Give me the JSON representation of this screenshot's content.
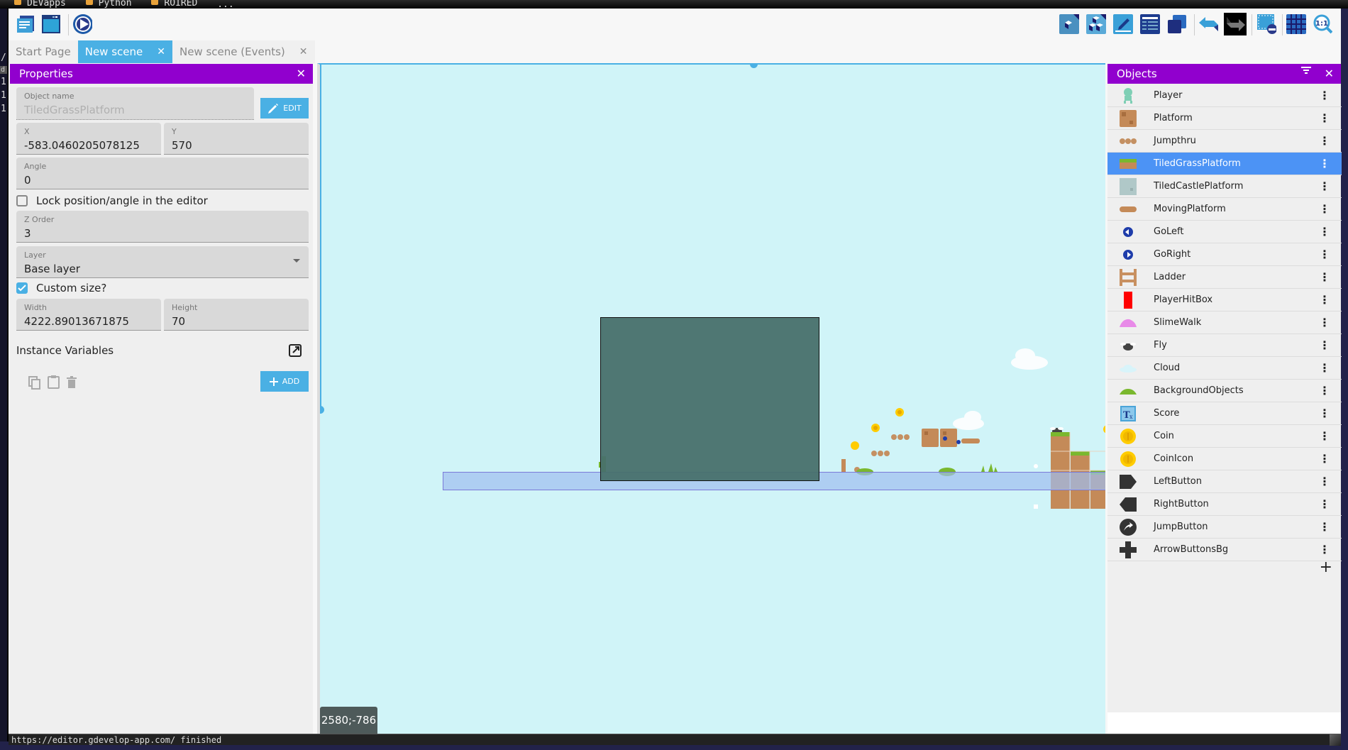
{
  "os": {
    "taskbar_items": [
      "DEVapps",
      "Python",
      "ROIRED",
      "..."
    ],
    "left_strip_chars": [
      "/",
      "d",
      "1",
      "1",
      "1"
    ]
  },
  "toolbar": {
    "left_buttons": [
      {
        "icon": "project-manager-icon",
        "label": "Project manager"
      },
      {
        "icon": "scene-window-icon",
        "label": "Scene"
      },
      {
        "icon": "play-preview-icon",
        "label": "Preview"
      }
    ],
    "right_buttons": [
      {
        "icon": "object-icon",
        "label": "Open object"
      },
      {
        "icon": "object-groups-icon",
        "label": "Object groups"
      },
      {
        "icon": "properties-edit-icon",
        "label": "Properties"
      },
      {
        "icon": "instances-list-icon",
        "label": "Instances list"
      },
      {
        "icon": "layers-icon",
        "label": "Layers"
      },
      {
        "icon": "undo-icon",
        "label": "Undo"
      },
      {
        "icon": "redo-icon",
        "label": "Redo"
      },
      {
        "icon": "delete-selection-icon",
        "label": "Delete selection"
      },
      {
        "icon": "grid-icon",
        "label": "Grid"
      },
      {
        "icon": "zoom-reset-icon",
        "label": "1:1"
      }
    ]
  },
  "tabs": [
    {
      "label": "Start Page",
      "closable": false,
      "active": false
    },
    {
      "label": "New scene",
      "closable": true,
      "active": true
    },
    {
      "label": "New scene (Events)",
      "closable": true,
      "active": false
    }
  ],
  "tab_close_glyph": "✕",
  "properties": {
    "title": "Properties",
    "close_glyph": "✕",
    "object_name_label": "Object name",
    "object_name_value": "TiledGrassPlatform",
    "edit_label": "EDIT",
    "x_label": "X",
    "x_value": "-583.0460205078125",
    "y_label": "Y",
    "y_value": "570",
    "angle_label": "Angle",
    "angle_value": "0",
    "lock_label": "Lock position/angle in the editor",
    "lock_checked": false,
    "zorder_label": "Z Order",
    "zorder_value": "3",
    "layer_label": "Layer",
    "layer_value": "Base layer",
    "custom_size_label": "Custom size?",
    "custom_size_checked": true,
    "width_label": "Width",
    "width_value": "4222.89013671875",
    "height_label": "Height",
    "height_value": "70",
    "instance_variables_label": "Instance Variables",
    "add_label": "ADD"
  },
  "canvas": {
    "cursor_coords": "2580;-786",
    "background_color": "#d0f4f8"
  },
  "objects": {
    "title": "Objects",
    "selected": "TiledGrassPlatform",
    "items": [
      {
        "name": "Player",
        "icon": "player-icon"
      },
      {
        "name": "Platform",
        "icon": "platform-icon"
      },
      {
        "name": "Jumpthru",
        "icon": "jumpthru-icon"
      },
      {
        "name": "TiledGrassPlatform",
        "icon": "tiled-grass-icon"
      },
      {
        "name": "TiledCastlePlatform",
        "icon": "tiled-castle-icon"
      },
      {
        "name": "MovingPlatform",
        "icon": "moving-platform-icon"
      },
      {
        "name": "GoLeft",
        "icon": "go-left-icon"
      },
      {
        "name": "GoRight",
        "icon": "go-right-icon"
      },
      {
        "name": "Ladder",
        "icon": "ladder-icon"
      },
      {
        "name": "PlayerHitBox",
        "icon": "hitbox-icon"
      },
      {
        "name": "SlimeWalk",
        "icon": "slime-icon"
      },
      {
        "name": "Fly",
        "icon": "fly-icon"
      },
      {
        "name": "Cloud",
        "icon": "cloud-icon"
      },
      {
        "name": "BackgroundObjects",
        "icon": "bush-icon"
      },
      {
        "name": "Score",
        "icon": "text-object-icon"
      },
      {
        "name": "Coin",
        "icon": "coin-icon"
      },
      {
        "name": "CoinIcon",
        "icon": "coin-icon"
      },
      {
        "name": "LeftButton",
        "icon": "left-button-icon"
      },
      {
        "name": "RightButton",
        "icon": "right-button-icon"
      },
      {
        "name": "JumpButton",
        "icon": "jump-button-icon"
      },
      {
        "name": "ArrowButtonsBg",
        "icon": "dpad-icon"
      }
    ],
    "add_glyph": "+"
  },
  "statusbar": {
    "text": "https://editor.gdevelop-app.com/ finished"
  },
  "colors": {
    "panel_header": "#9100ce",
    "accent_blue": "#4ab0e4",
    "selected_row": "#4c93f5"
  }
}
